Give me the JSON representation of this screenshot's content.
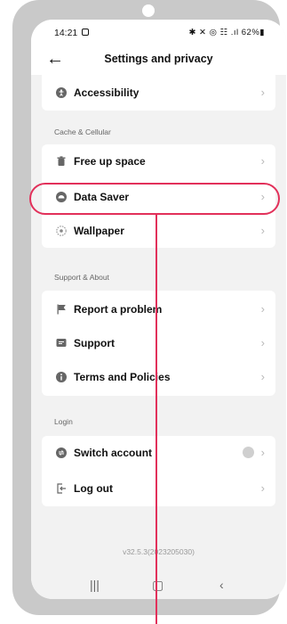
{
  "status_bar": {
    "time": "14:21",
    "indicators": "✱ ✕ ◎ ☷ .ıl 62%▮"
  },
  "header": {
    "back_icon": "←",
    "title": "Settings and privacy"
  },
  "rows": {
    "accessibility": {
      "label": "Accessibility",
      "icon": "accessibility-icon"
    },
    "free_up_space": {
      "label": "Free up space",
      "icon": "trash-icon"
    },
    "data_saver": {
      "label": "Data Saver",
      "icon": "data-saver-icon"
    },
    "wallpaper": {
      "label": "Wallpaper",
      "icon": "wallpaper-icon"
    },
    "report_problem": {
      "label": "Report a problem",
      "icon": "flag-icon"
    },
    "support": {
      "label": "Support",
      "icon": "chat-icon"
    },
    "terms": {
      "label": "Terms and Policies",
      "icon": "info-icon"
    },
    "switch_account": {
      "label": "Switch account",
      "icon": "switch-icon"
    },
    "log_out": {
      "label": "Log out",
      "icon": "logout-icon"
    }
  },
  "sections": {
    "cache": "Cache & Cellular",
    "support": "Support & About",
    "login": "Login"
  },
  "chevron": "›",
  "version": "v32.5.3(2023205030)",
  "nav": {
    "recents": "|||",
    "home": "▢",
    "back": "‹"
  },
  "colors": {
    "highlight": "#e2305a",
    "background": "#f2f2f2",
    "card": "#ffffff"
  }
}
